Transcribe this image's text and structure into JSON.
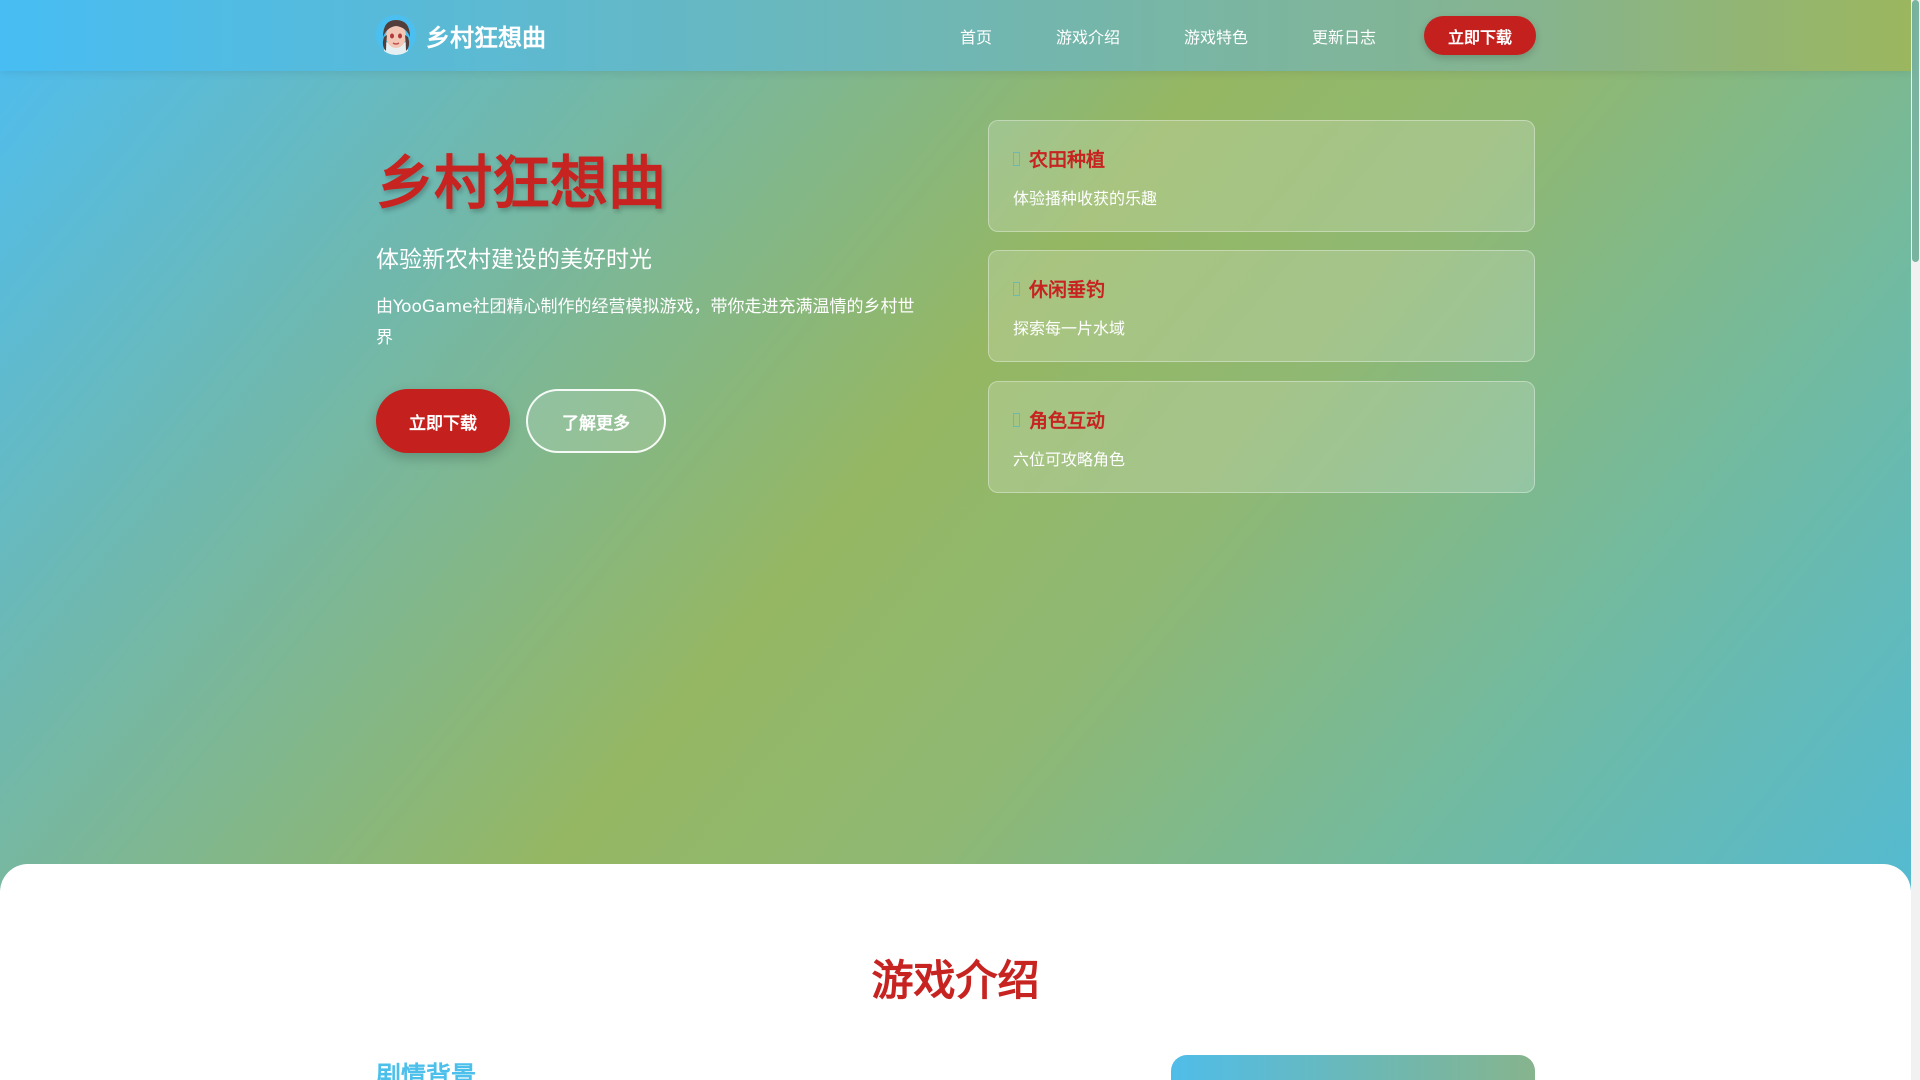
{
  "colors": {
    "accent_red": "#c4201d",
    "title_red": "#c72421",
    "accent_blue": "#4cc0eb",
    "accent_green": "#95b763",
    "white": "#ffffff"
  },
  "navbar": {
    "brand_name": "乡村狂想曲",
    "avatar_icon": "game-character-avatar",
    "links": [
      "首页",
      "游戏介绍",
      "游戏特色",
      "更新日志"
    ],
    "download_label": "立即下载"
  },
  "hero": {
    "title": "乡村狂想曲",
    "subtitle": "体验新农村建设的美好时光",
    "description": "由YooGame社团精心制作的经营模拟游戏，带你走进充满温情的乡村世界",
    "primary_button": "立即下载",
    "secondary_button": "了解更多"
  },
  "features": [
    {
      "icon": "plant-icon",
      "title": "农田种植",
      "desc": "体验播种收获的乐趣"
    },
    {
      "icon": "fishing-icon",
      "title": "休闲垂钓",
      "desc": "探索每一片水域"
    },
    {
      "icon": "user-icon",
      "title": "角色互动",
      "desc": "六位可攻略角色"
    }
  ],
  "intro": {
    "title": "游戏介绍",
    "subtitle": "剧情背景"
  }
}
